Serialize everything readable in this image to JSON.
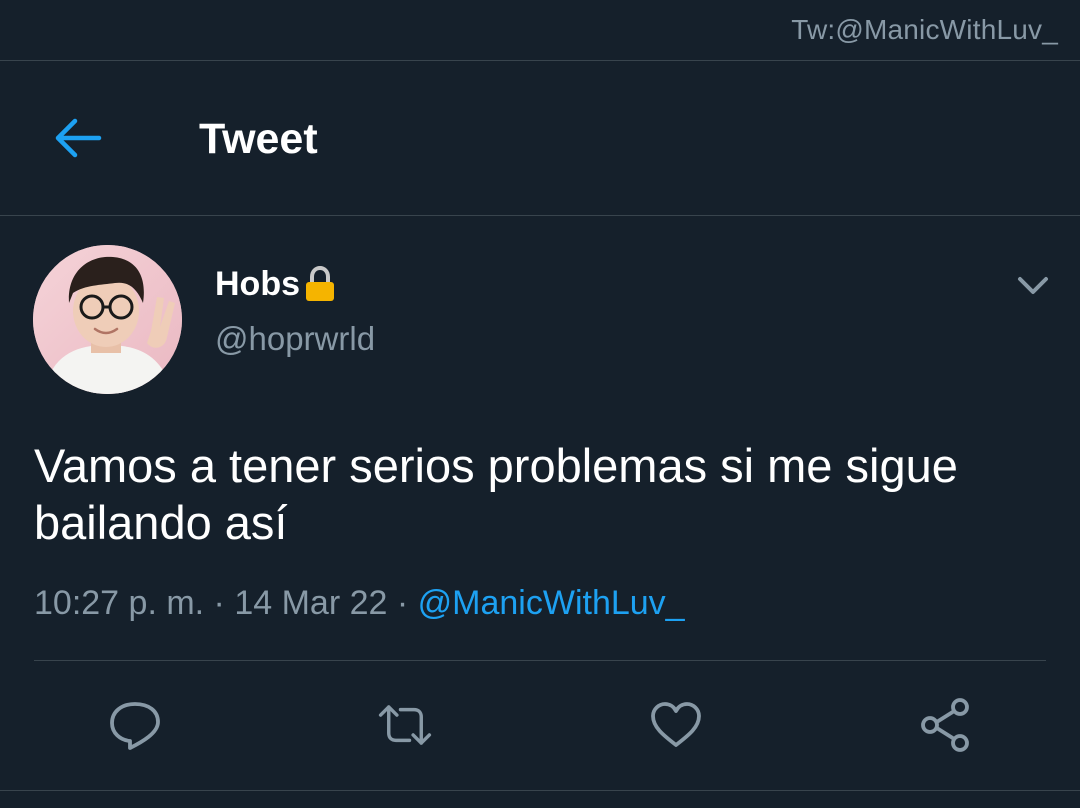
{
  "watermark": "Tw:@ManicWithLuv_",
  "header": {
    "back_icon": "arrow-left-icon",
    "title": "Tweet"
  },
  "tweet": {
    "author": {
      "display_name": "Hobs",
      "protected_icon": "lock-icon",
      "handle": "@hoprwrld",
      "avatar_icon": "avatar-photo"
    },
    "menu_icon": "chevron-down-icon",
    "text": "Vamos a tener serios problemas si me sigue bailando así",
    "meta": {
      "time": "10:27 p. m.",
      "separator1": " · ",
      "date": "14 Mar 22",
      "separator2": " · ",
      "via": "@ManicWithLuv_"
    },
    "actions": [
      {
        "name": "reply",
        "icon": "reply-icon"
      },
      {
        "name": "retweet",
        "icon": "retweet-icon"
      },
      {
        "name": "like",
        "icon": "heart-icon"
      },
      {
        "name": "share",
        "icon": "share-icon"
      }
    ]
  },
  "colors": {
    "background": "#15202b",
    "accent": "#1da1f2",
    "muted_text": "#8899a6",
    "divider": "#38444d",
    "lock": "#f5b400"
  }
}
